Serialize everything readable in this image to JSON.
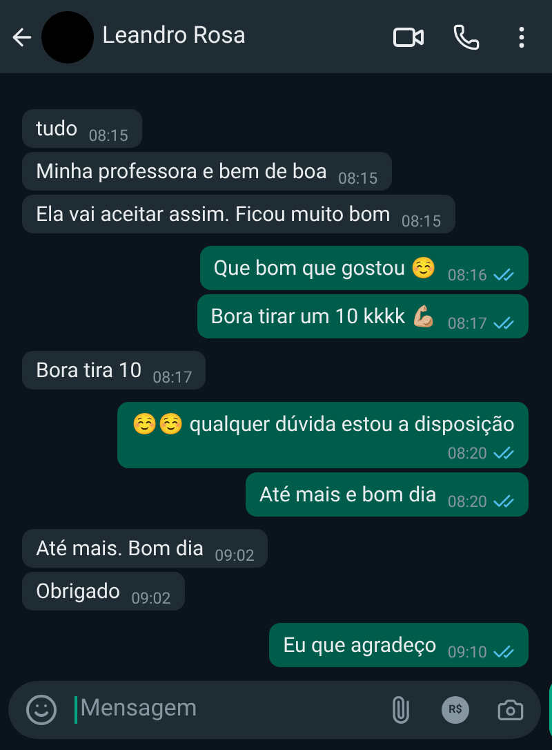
{
  "header": {
    "contact_name": "Leandro Rosa"
  },
  "messages": [
    {
      "kind": "in",
      "text": "tudo",
      "time": "08:15"
    },
    {
      "kind": "in",
      "text": "Minha professora e bem de boa",
      "time": "08:15"
    },
    {
      "kind": "in",
      "text": "Ela vai aceitar assim. Ficou muito bom",
      "time": "08:15"
    },
    {
      "kind": "out",
      "text": "Que bom que gostou ☺️",
      "time": "08:16",
      "read": true
    },
    {
      "kind": "out",
      "text": "Bora tirar um 10 kkkk 💪🏼",
      "time": "08:17",
      "read": true
    },
    {
      "kind": "in",
      "text": "Bora tira 10",
      "time": "08:17"
    },
    {
      "kind": "out",
      "text": "☺️☺️ qualquer dúvida estou a disposição",
      "time": "08:20",
      "read": true
    },
    {
      "kind": "out",
      "text": "Até mais e bom dia",
      "time": "08:20",
      "read": true
    },
    {
      "kind": "in",
      "text": "Até mais. Bom dia",
      "time": "09:02"
    },
    {
      "kind": "in",
      "text": "Obrigado",
      "time": "09:02"
    },
    {
      "kind": "out",
      "text": "Eu que agradeço",
      "time": "09:10",
      "read": true
    }
  ],
  "composer": {
    "placeholder": "Mensagem",
    "payment_label": "R$"
  }
}
